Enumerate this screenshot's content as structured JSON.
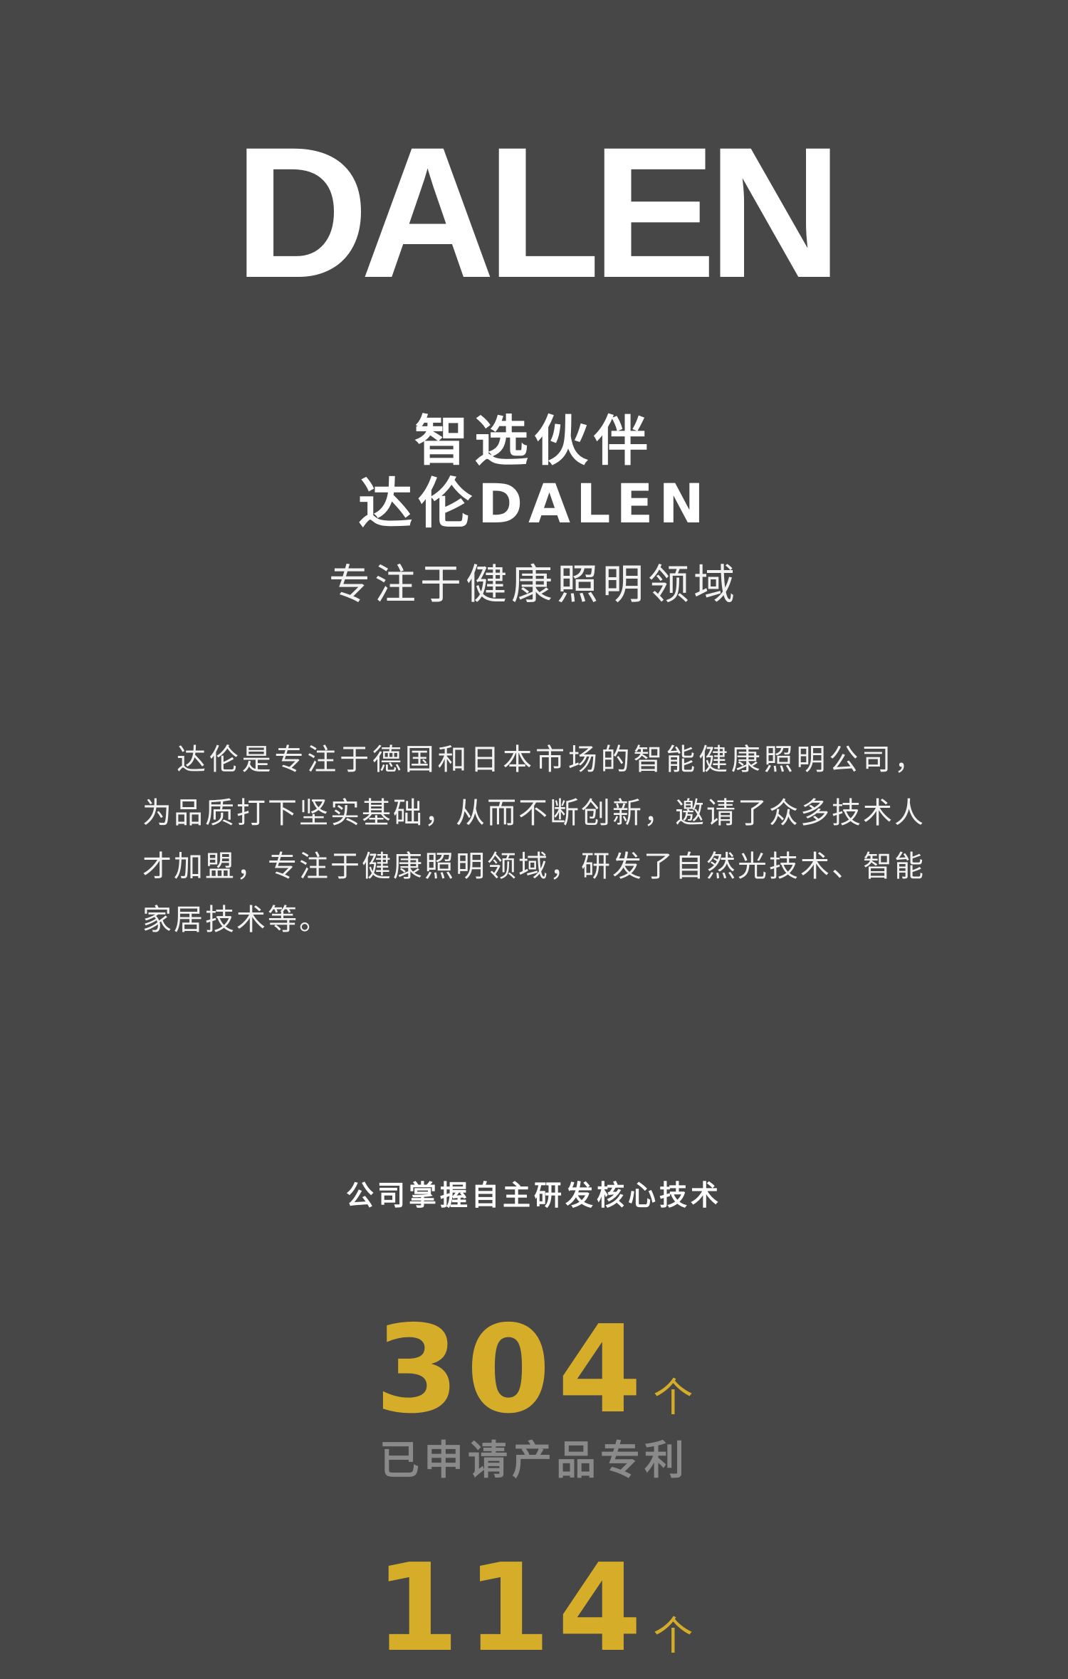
{
  "logo": {
    "text": "DALEN"
  },
  "hero": {
    "line1": "智选伙伴",
    "line2": "达伦DALEN",
    "subtitle": "专注于健康照明领域"
  },
  "intro": {
    "paragraph": "达伦是专注于德国和日本市场的智能健康照明公司，为品质打下坚实基础，从而不断创新，邀请了众多技术人才加盟，专注于健康照明领域，研发了自然光技术、智能家居技术等。"
  },
  "stats_section": {
    "heading": "公司掌握自主研发核心技术",
    "items": [
      {
        "number": "304",
        "unit": "个",
        "label": "已申请产品专利"
      },
      {
        "number": "114",
        "unit": "个"
      }
    ]
  },
  "colors": {
    "background": "#474747",
    "accent": "#d5ad29",
    "muted": "#8a8a8a"
  }
}
